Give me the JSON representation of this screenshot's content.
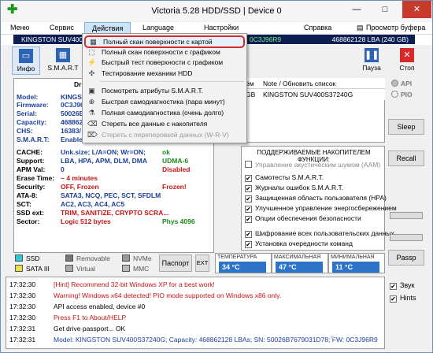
{
  "window": {
    "title": "Victoria 5.28 HDD/SSD | Device 0",
    "minimize": "—",
    "maximize": "□",
    "close": "✕"
  },
  "menu": {
    "file": "Меню",
    "service": "Сервис",
    "actions": "Действия",
    "language": "Language",
    "settings": "Настройки",
    "help": "Справка",
    "clipboard_view": "Просмотр буфера"
  },
  "device_strip": {
    "model": "KINGSTON SUV400S",
    "serial": "0C3J96R9",
    "lba": "468862128 LBA (240 GB)"
  },
  "toolbar": {
    "info": "Инфо",
    "smart": "S.M.A.R.T",
    "pause": "Пауза",
    "stop": "Стоп"
  },
  "dropdown": {
    "items": [
      {
        "label": "Полный скан поверхности с картой",
        "icon": "grid-scan-icon"
      },
      {
        "label": "Полный скан поверхности с графиком",
        "icon": "graph-scan-icon"
      },
      {
        "label": "Быстрый тест поверхности с графиком",
        "icon": "lightning-icon"
      },
      {
        "label": "Тестирование механики HDD",
        "icon": "mechanics-icon"
      },
      {
        "label": "Посмотреть атрибуты S.M.A.R.T.",
        "icon": "smart-icon"
      },
      {
        "label": "Быстрая самодиагностика (пара минут)",
        "icon": "quick-diag-icon"
      },
      {
        "label": "Полная самодиагностика (очень долго)",
        "icon": "full-diag-icon"
      },
      {
        "label": "Стереть все данные с накопителя",
        "icon": "erase-icon"
      },
      {
        "label": "Стереть с переперовкой данных (W-R-V)",
        "icon": "erase-verify-icon"
      }
    ]
  },
  "info": {
    "drive_label": "Dri",
    "rows": [
      {
        "k": "Model:",
        "v": "KINGST"
      },
      {
        "k": "Firmware:",
        "v": "0C3J96"
      },
      {
        "k": "Serial:",
        "v": "50026B"
      },
      {
        "k": "Capacity:",
        "v": "468862"
      },
      {
        "k": "CHS:",
        "v": "16383/"
      },
      {
        "k": "S.M.A.R.T:",
        "v": "Enabled,"
      },
      {
        "k": "CACHE:",
        "v": "Unk.size; L/A=ON; Wr=ON;",
        "v2": "ok"
      },
      {
        "k": "Support:",
        "v": "LBA, HPA, APM, DLM, DMA",
        "v2": "UDMA-6"
      },
      {
        "k": "APM Val:",
        "v": "0",
        "v2": "Disabled"
      },
      {
        "k": "Erase Time:",
        "v": "~ 4 minutes"
      },
      {
        "k": "Security:",
        "v": "OFF, Frozen",
        "v2": "Frozen!"
      },
      {
        "k": "ATA-8:",
        "v": "SATA3, NCQ, PEC, SCT, SFDLM"
      },
      {
        "k": "SCT:",
        "v": "AC2, AC3, AC4, AC5"
      },
      {
        "k": "SSD ext:",
        "v": "TRIM, SANITIZE, CRYPTO SCRA..."
      },
      {
        "k": "Sector:",
        "v": "Logic 512 bytes",
        "v2": "Phys 4096"
      }
    ]
  },
  "device_list": {
    "col_size_tail": "ём",
    "col_model": "Note / Обновить список",
    "row_size_tail": "GB",
    "row_model": "KINGSTON SUV400S37240G"
  },
  "features": {
    "title": "ПОДДЕРЖИВАЕМЫЕ НАКОПИТЕЛЕМ ФУНКЦИИ:",
    "items": [
      {
        "label": "Управление акустическим шумом (AAM)",
        "checked": false,
        "disabled": true
      },
      {
        "label": "Самотесты S.M.A.R.T.",
        "checked": true
      },
      {
        "label": "Журналы ошибок S.M.A.R.T.",
        "checked": true
      },
      {
        "label": "Защищенная область пользователя (HPA)",
        "checked": true
      },
      {
        "label": "Улучшенное управление энергосбережением",
        "checked": true
      },
      {
        "label": "Опции обеспечения безопасности",
        "checked": true
      },
      {
        "label": "Шифрование всех пользовательских данных",
        "checked": true
      },
      {
        "label": "Установка очередности команд",
        "checked": true
      }
    ]
  },
  "right": {
    "api": "API",
    "pio": "PIO",
    "sleep": "Sleep",
    "recall": "Recall",
    "passp": "Passp"
  },
  "legend": {
    "ssd": "SSD",
    "sata3": "SATA III",
    "removable": "Removable",
    "virtual": "Virtual",
    "nvme": "NVMe",
    "mmc": "MMC",
    "passport": "Паспорт",
    "ext": "EXT"
  },
  "temps": [
    {
      "label": "ТЕМПЕРАТУРА",
      "value": "34 °C"
    },
    {
      "label": "МАКСИМАЛЬНАЯ",
      "value": "47 °C"
    },
    {
      "label": "МИНИМАЛЬНАЯ",
      "value": "11 °C"
    }
  ],
  "log": [
    {
      "time": "17:32:30",
      "text": "[Hint] Recommend 32-bit Windows XP for a best work!",
      "color": "red"
    },
    {
      "time": "17:32:30",
      "text": "Warning! Windows x64 detected! PIO mode supported on Windows x86 only.",
      "color": "red"
    },
    {
      "time": "17:32:30",
      "text": "API access enabled, device #0",
      "color": "black"
    },
    {
      "time": "17:32:30",
      "text": "Press F1 to About/HELP",
      "color": "red"
    },
    {
      "time": "17:32:31",
      "text": "Get drive passport... OK",
      "color": "black"
    },
    {
      "time": "17:32:31",
      "text": "Model: KINGSTON SUV400S37240G; Capacity: 468862128 LBAs; SN: 50026B7679031D78; FW: 0C3J96R9",
      "color": "blue"
    }
  ],
  "log_checks": {
    "sound": "Звук",
    "hints": "Hints"
  }
}
